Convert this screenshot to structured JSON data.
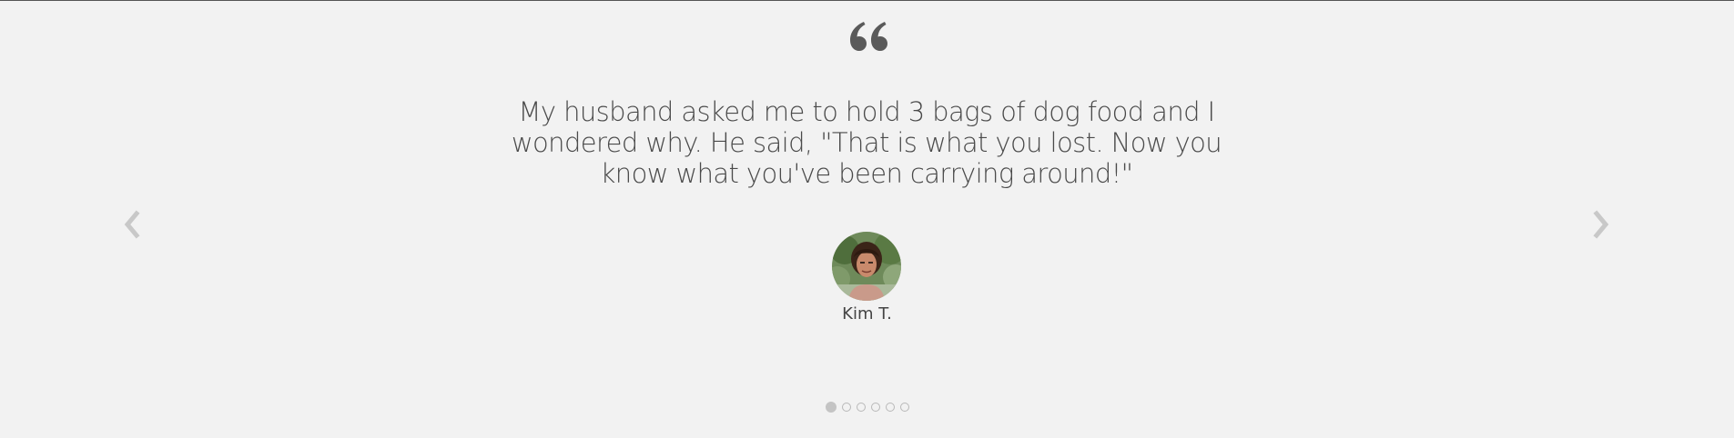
{
  "testimonial": {
    "quote_icon": "quote-open-icon",
    "text": "My husband asked me to hold 3 bags of dog food and I wondered why. He said, \"That is what you lost. Now you know what you've been carrying around!\"",
    "author_name": "Kim T."
  },
  "navigation": {
    "prev_icon": "chevron-left-icon",
    "next_icon": "chevron-right-icon"
  },
  "pagination": {
    "total": 6,
    "active_index": 0
  },
  "colors": {
    "background": "#f2f2f2",
    "text": "#4a4a4a",
    "quote_mark": "#5a5a5a",
    "arrow": "#c8c8c8",
    "dot": "#c4c4c4"
  }
}
